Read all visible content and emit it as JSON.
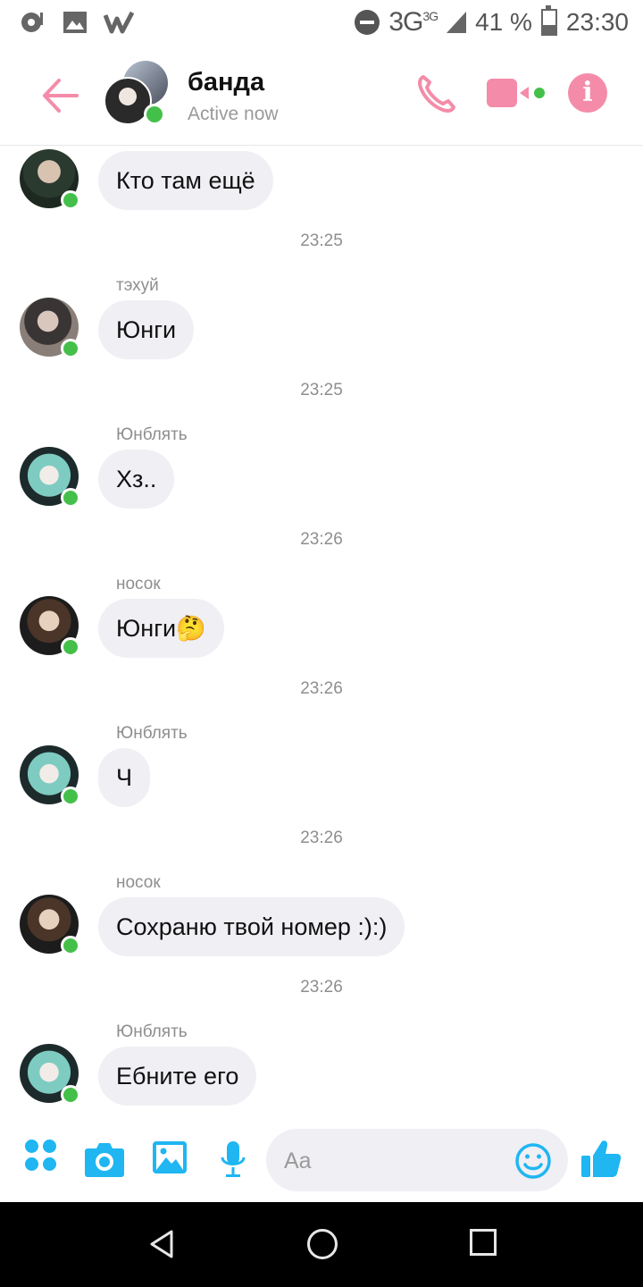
{
  "status_bar": {
    "network": "3G",
    "network_sup": "3G",
    "battery": "41 %",
    "time": "23:30"
  },
  "header": {
    "title": "банда",
    "status": "Active now"
  },
  "messages": [
    {
      "sender": "",
      "text": "Кто там ещё",
      "avatar": "av-jk"
    },
    {
      "time": "23:25",
      "sender": "тэхуй",
      "text": "Юнги",
      "avatar": "av-tae"
    },
    {
      "time": "23:25",
      "sender": "Юнблять",
      "text": "Хз..",
      "avatar": "av-yg"
    },
    {
      "time": "23:26",
      "sender": "носок",
      "text": "Юнги🤔",
      "avatar": "av-jm"
    },
    {
      "time": "23:26",
      "sender": "Юнблять",
      "text": "Ч",
      "avatar": "av-yg"
    },
    {
      "time": "23:26",
      "sender": "носок",
      "text": "Сохраню твой номер :):)",
      "avatar": "av-jm"
    },
    {
      "time": "23:26",
      "sender": "Юнблять",
      "text": "Ебните его",
      "avatar": "av-yg"
    }
  ],
  "composer": {
    "placeholder": "Aa"
  },
  "colors": {
    "accent_pink": "#f48ca9",
    "accent_blue": "#1fb6f2",
    "online": "#44c04a",
    "bubble": "#f0eff4"
  }
}
